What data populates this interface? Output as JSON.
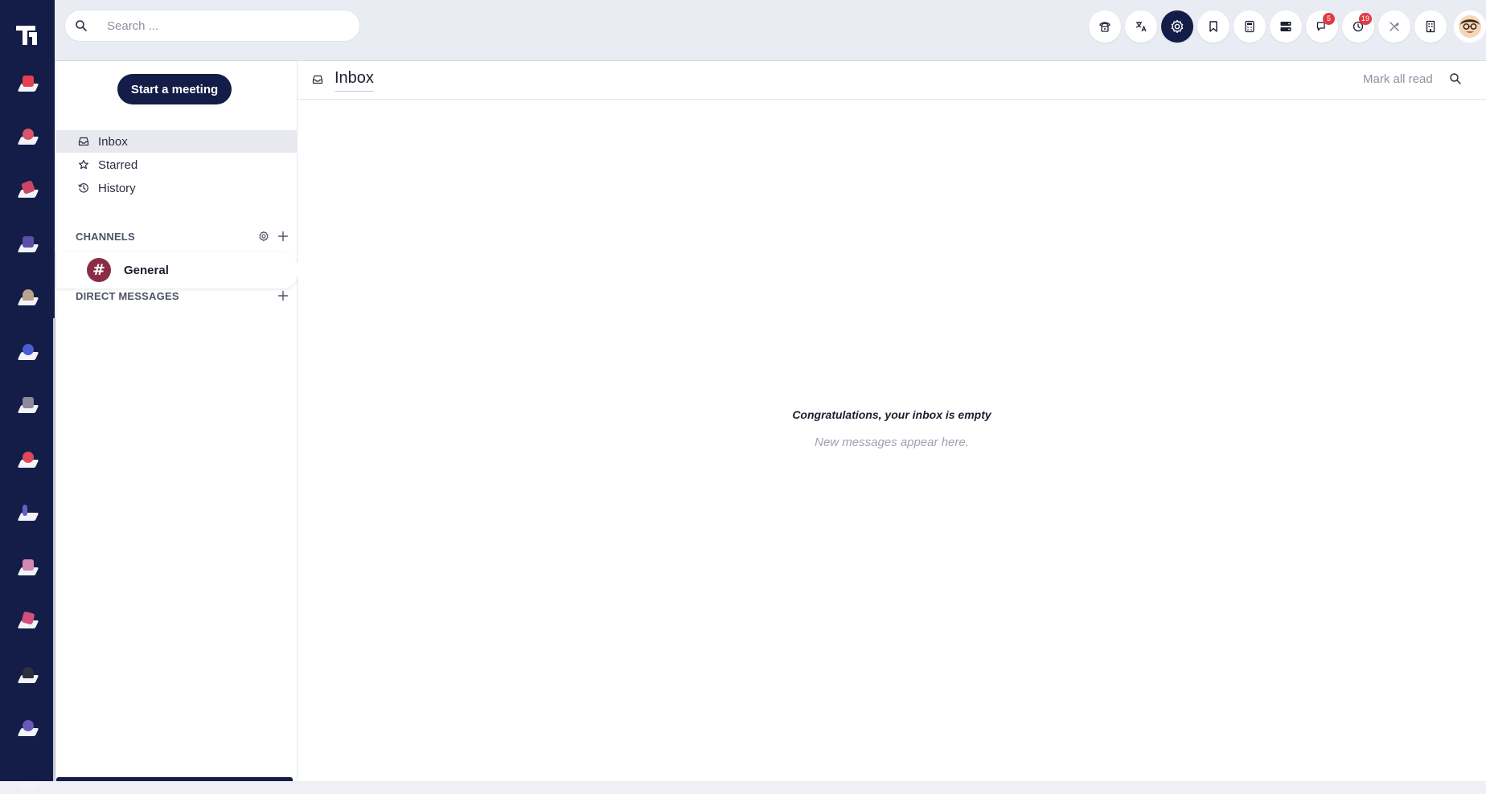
{
  "search": {
    "placeholder": "Search ..."
  },
  "sidebar": {
    "meet_label": "Start a meeting",
    "nav": [
      {
        "label": "Inbox",
        "icon": "inbox-icon",
        "selected": true
      },
      {
        "label": "Starred",
        "icon": "star-icon"
      },
      {
        "label": "History",
        "icon": "history-icon"
      }
    ],
    "channels_label": "CHANNELS",
    "channels": [
      {
        "name": "General",
        "icon": "hash-icon"
      }
    ],
    "dm_label": "DIRECT MESSAGES"
  },
  "topbar": {
    "icons": [
      "phone-icon",
      "translate-icon",
      "settings-icon",
      "bookmark-icon",
      "calculator-icon",
      "server-icon",
      "chat-icon",
      "timer-icon",
      "tools-icon",
      "building-icon"
    ],
    "chat_badge": "5",
    "timer_badge": "19"
  },
  "main": {
    "title": "Inbox",
    "mark_all_read": "Mark all read",
    "empty_title": "Congratulations, your inbox is empty",
    "empty_sub": "New messages appear here."
  },
  "colors": {
    "rail": "#131d47",
    "accent": "#131d47",
    "badge": "#e03b45",
    "channel": "#8a2c45"
  }
}
